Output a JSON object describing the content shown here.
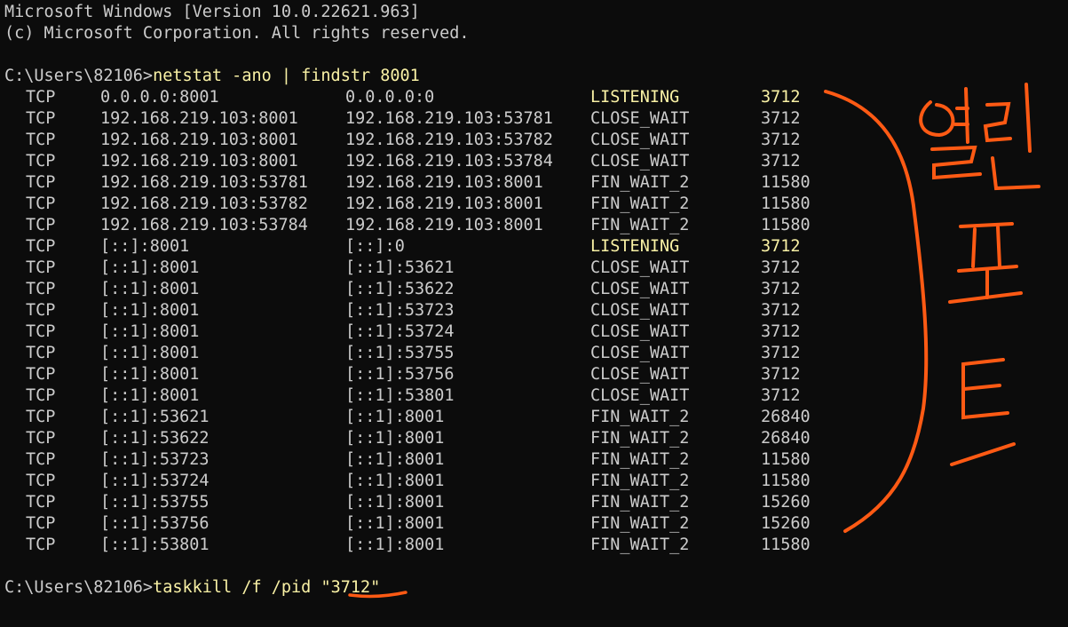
{
  "header": {
    "version_line": "Microsoft Windows [Version 10.0.22621.963]",
    "copyright_line": "(c) Microsoft Corporation. All rights reserved."
  },
  "prompt1": {
    "path": "C:\\Users\\82106>",
    "command": "netstat -ano | findstr 8001"
  },
  "rows": [
    {
      "proto": "TCP",
      "local": "0.0.0.0:8001",
      "foreign": "0.0.0.0:0",
      "state": "LISTENING",
      "pid": "3712"
    },
    {
      "proto": "TCP",
      "local": "192.168.219.103:8001",
      "foreign": "192.168.219.103:53781",
      "state": "CLOSE_WAIT",
      "pid": "3712"
    },
    {
      "proto": "TCP",
      "local": "192.168.219.103:8001",
      "foreign": "192.168.219.103:53782",
      "state": "CLOSE_WAIT",
      "pid": "3712"
    },
    {
      "proto": "TCP",
      "local": "192.168.219.103:8001",
      "foreign": "192.168.219.103:53784",
      "state": "CLOSE_WAIT",
      "pid": "3712"
    },
    {
      "proto": "TCP",
      "local": "192.168.219.103:53781",
      "foreign": "192.168.219.103:8001",
      "state": "FIN_WAIT_2",
      "pid": "11580"
    },
    {
      "proto": "TCP",
      "local": "192.168.219.103:53782",
      "foreign": "192.168.219.103:8001",
      "state": "FIN_WAIT_2",
      "pid": "11580"
    },
    {
      "proto": "TCP",
      "local": "192.168.219.103:53784",
      "foreign": "192.168.219.103:8001",
      "state": "FIN_WAIT_2",
      "pid": "11580"
    },
    {
      "proto": "TCP",
      "local": "[::]:8001",
      "foreign": "[::]:0",
      "state": "LISTENING",
      "pid": "3712"
    },
    {
      "proto": "TCP",
      "local": "[::1]:8001",
      "foreign": "[::1]:53621",
      "state": "CLOSE_WAIT",
      "pid": "3712"
    },
    {
      "proto": "TCP",
      "local": "[::1]:8001",
      "foreign": "[::1]:53622",
      "state": "CLOSE_WAIT",
      "pid": "3712"
    },
    {
      "proto": "TCP",
      "local": "[::1]:8001",
      "foreign": "[::1]:53723",
      "state": "CLOSE_WAIT",
      "pid": "3712"
    },
    {
      "proto": "TCP",
      "local": "[::1]:8001",
      "foreign": "[::1]:53724",
      "state": "CLOSE_WAIT",
      "pid": "3712"
    },
    {
      "proto": "TCP",
      "local": "[::1]:8001",
      "foreign": "[::1]:53755",
      "state": "CLOSE_WAIT",
      "pid": "3712"
    },
    {
      "proto": "TCP",
      "local": "[::1]:8001",
      "foreign": "[::1]:53756",
      "state": "CLOSE_WAIT",
      "pid": "3712"
    },
    {
      "proto": "TCP",
      "local": "[::1]:8001",
      "foreign": "[::1]:53801",
      "state": "CLOSE_WAIT",
      "pid": "3712"
    },
    {
      "proto": "TCP",
      "local": "[::1]:53621",
      "foreign": "[::1]:8001",
      "state": "FIN_WAIT_2",
      "pid": "26840"
    },
    {
      "proto": "TCP",
      "local": "[::1]:53622",
      "foreign": "[::1]:8001",
      "state": "FIN_WAIT_2",
      "pid": "26840"
    },
    {
      "proto": "TCP",
      "local": "[::1]:53723",
      "foreign": "[::1]:8001",
      "state": "FIN_WAIT_2",
      "pid": "11580"
    },
    {
      "proto": "TCP",
      "local": "[::1]:53724",
      "foreign": "[::1]:8001",
      "state": "FIN_WAIT_2",
      "pid": "11580"
    },
    {
      "proto": "TCP",
      "local": "[::1]:53755",
      "foreign": "[::1]:8001",
      "state": "FIN_WAIT_2",
      "pid": "15260"
    },
    {
      "proto": "TCP",
      "local": "[::1]:53756",
      "foreign": "[::1]:8001",
      "state": "FIN_WAIT_2",
      "pid": "15260"
    },
    {
      "proto": "TCP",
      "local": "[::1]:53801",
      "foreign": "[::1]:8001",
      "state": "FIN_WAIT_2",
      "pid": "11580"
    }
  ],
  "prompt2": {
    "path": "C:\\Users\\82106>",
    "command": "taskkill /f /pid ",
    "quoted_pid": "\"3712\""
  },
  "annotation": {
    "handwritten_text": "열린 포트",
    "color": "#ff5a14"
  },
  "colors": {
    "background": "#0c0c0c",
    "foreground": "#cccccc",
    "highlight": "#f9f1a5"
  }
}
